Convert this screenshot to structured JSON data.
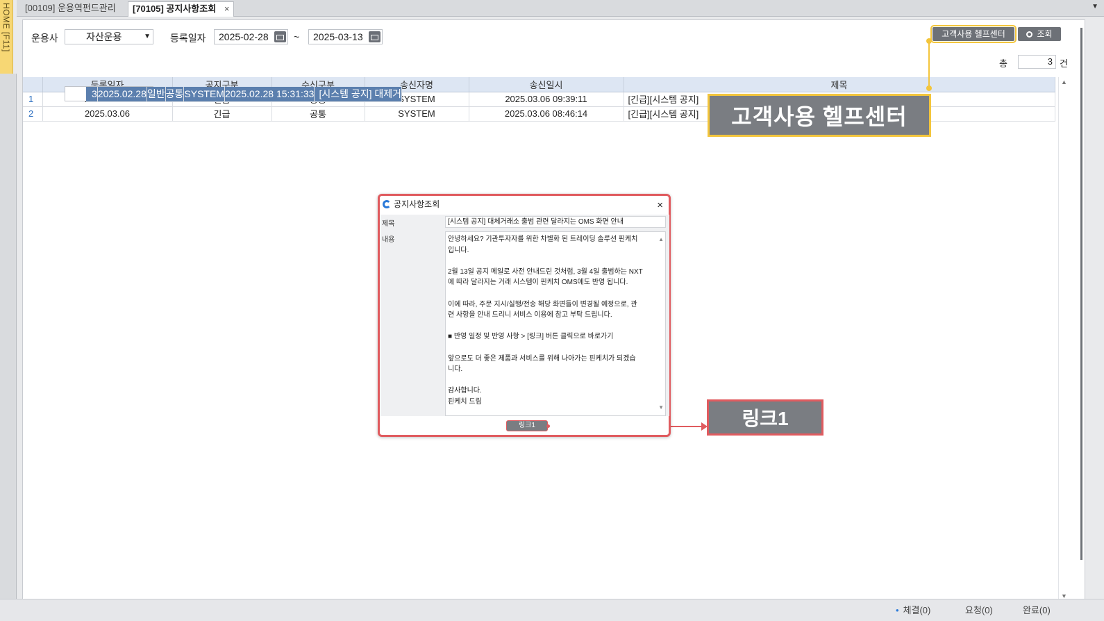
{
  "home_strip": "HOME [F11]",
  "tabs": [
    {
      "label": "[00109] 운용역펀드관리"
    },
    {
      "label": "[70105] 공지사항조회",
      "close": "×"
    }
  ],
  "filter": {
    "company_label": "운용사",
    "company_value": "자산운용",
    "date_label": "등록일자",
    "date_from": "2025-02-28",
    "tilde": "~",
    "date_to": "2025-03-13"
  },
  "buttons": {
    "help_center": "고객사용 헬프센터",
    "search": "조회"
  },
  "count": {
    "prefix": "총",
    "value": "3",
    "unit": "건"
  },
  "grid": {
    "columns": [
      "등록일자",
      "공지구분",
      "수신구분",
      "송신자명",
      "송신일시",
      "제목"
    ],
    "rows": [
      {
        "no": "1",
        "date": "2025.03.06",
        "type": "긴급",
        "recv": "공통",
        "sender": "SYSTEM",
        "sent": "2025.03.06 09:39:11",
        "title": "[긴급][시스템 공지]"
      },
      {
        "no": "2",
        "date": "2025.03.06",
        "type": "긴급",
        "recv": "공통",
        "sender": "SYSTEM",
        "sent": "2025.03.06 08:46:14",
        "title": "[긴급][시스템 공지]"
      },
      {
        "no": "3",
        "date": "2025.02.28",
        "type": "일반",
        "recv": "공통",
        "sender": "SYSTEM",
        "sent": "2025.02.28 15:31:33",
        "title": "[시스템 공지] 대제거"
      }
    ]
  },
  "callouts": {
    "help_center": "고객사용 헬프센터",
    "link": "링크1"
  },
  "dialog": {
    "title": "공지사항조회",
    "close": "×",
    "title_label": "제목",
    "title_value": "[시스템 공지] 대체거래소 출범 관련 달라지는 OMS 화면 안내",
    "content_label": "내용",
    "content_lines": [
      "안녕하세요? 기관투자자를 위한 차별화 된 트레이딩 솔루션 핀케치",
      "입니다.",
      "",
      "2월 13일 공지 메일로 사전 안내드린 것처럼, 3월 4일 출범하는 NXT",
      "에 따라 달라지는 거래 시스템이 핀케치 OMS에도 반영 됩니다.",
      "",
      "이에 따라, 주문 지시/실행/전송 해당 화면들이 변경될 예정으로, 관",
      "련 사항을 안내 드리니 서비스 이용에 참고 부탁 드립니다.",
      "",
      "■ 반영 일정 및 반영 사항 > [링크] 버튼 클릭으로 바로가기",
      "",
      "앞으로도 더 좋은 제품과 서비스를 위해 나아가는 핀케치가 되겠습",
      "니다.",
      "",
      "감사합니다.",
      "핀케치 드림"
    ],
    "link_button": "링크1"
  },
  "status": {
    "filled": "체결(0)",
    "requested": "요청(0)",
    "completed": "완료(0)"
  }
}
